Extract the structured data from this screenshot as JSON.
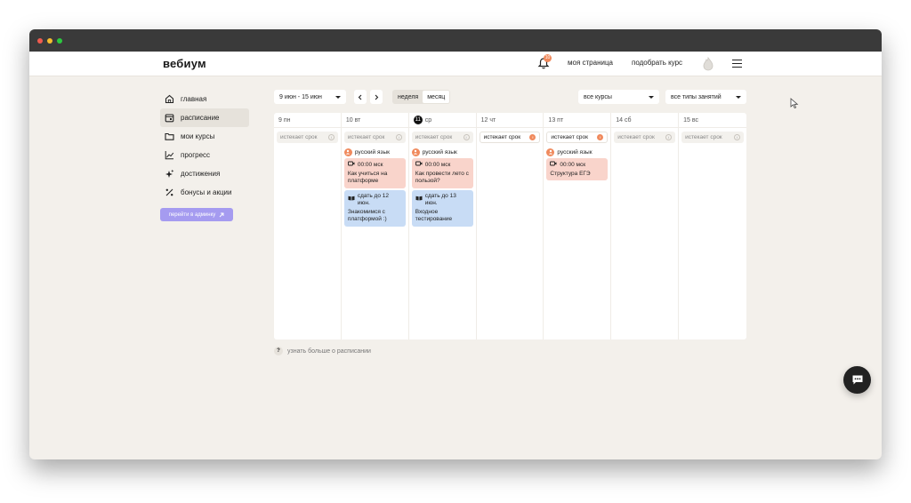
{
  "brand": {
    "name": "вебиум"
  },
  "topnav": {
    "notifications_count": "10",
    "my_page": "моя страница",
    "pick_course": "подобрать курс"
  },
  "sidebar": {
    "items": [
      {
        "label": "главная",
        "icon": "home-icon"
      },
      {
        "label": "расписание",
        "icon": "calendar-icon",
        "active": true
      },
      {
        "label": "мои курсы",
        "icon": "folder-icon"
      },
      {
        "label": "прогресс",
        "icon": "chart-icon"
      },
      {
        "label": "достижения",
        "icon": "sparkle-icon"
      },
      {
        "label": "бонусы и акции",
        "icon": "percent-icon"
      }
    ],
    "admin_button": "перейти в админку"
  },
  "toolbar": {
    "week_range": "9 июн - 15 июн",
    "view_week": "неделя",
    "view_month": "месяц",
    "filter_courses": "все курсы",
    "filter_types": "все типы занятий"
  },
  "days": [
    {
      "num": "9",
      "day": "пн",
      "deadline": "истекает срок",
      "deadline_alert": false,
      "course": "",
      "lessons": []
    },
    {
      "num": "10",
      "day": "вт",
      "deadline": "истекает срок",
      "deadline_alert": false,
      "course": "русский язык",
      "lessons": [
        {
          "type": "live",
          "meta": "00:00 мск",
          "title": "Как учиться на платформе"
        },
        {
          "type": "task",
          "meta": "сдать до 12 июн.",
          "title": "Знакомимся с платформой :)"
        }
      ]
    },
    {
      "num": "11",
      "day": "ср",
      "today": true,
      "deadline": "истекает срок",
      "deadline_alert": false,
      "course": "русский язык",
      "lessons": [
        {
          "type": "live",
          "meta": "00:00 мск",
          "title": "Как провести лето с пользой?"
        },
        {
          "type": "task",
          "meta": "сдать до 13 июн.",
          "title": "Входное тестирование"
        }
      ]
    },
    {
      "num": "12",
      "day": "чт",
      "deadline": "истекает срок",
      "deadline_alert": true,
      "course": "",
      "lessons": []
    },
    {
      "num": "13",
      "day": "пт",
      "deadline": "истекает срок",
      "deadline_alert": true,
      "course": "русский язык",
      "lessons": [
        {
          "type": "live",
          "meta": "00:00 мск",
          "title": "Структура ЕГЭ"
        }
      ]
    },
    {
      "num": "14",
      "day": "сб",
      "deadline": "истекает срок",
      "deadline_alert": false,
      "course": "",
      "lessons": []
    },
    {
      "num": "15",
      "day": "вс",
      "deadline": "истекает срок",
      "deadline_alert": false,
      "course": "",
      "lessons": []
    }
  ],
  "help": {
    "q": "?",
    "text": "узнать больше о расписании"
  },
  "colors": {
    "accent_orange": "#f08a5d",
    "live_lesson_bg": "#f9d4cb",
    "task_bg": "#c8dcf5",
    "admin_button": "#a59bf0",
    "page_bg": "#f3f0eb"
  }
}
